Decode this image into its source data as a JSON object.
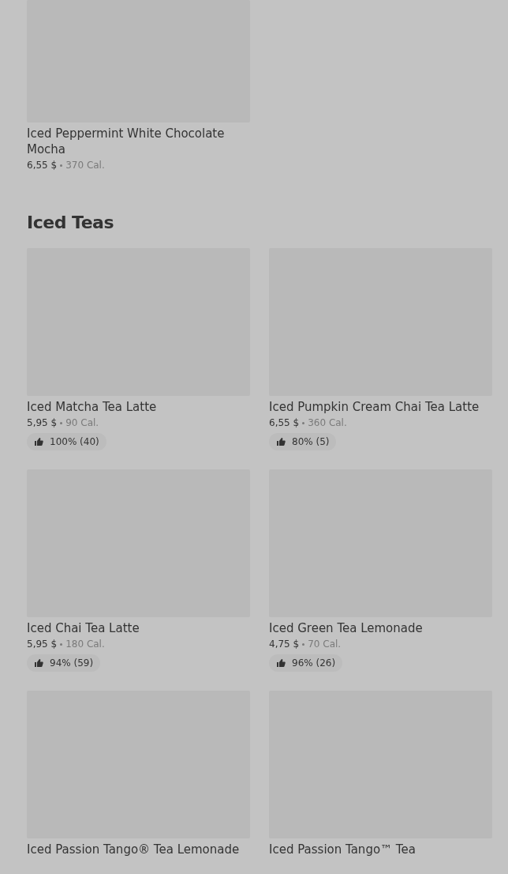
{
  "top_item": {
    "name": "Iced Peppermint White Chocolate Mocha",
    "price": "6,55 $",
    "calories": "370 Cal."
  },
  "section": {
    "title": "Iced Teas",
    "items": [
      {
        "name": "Iced Matcha Tea Latte",
        "price": "5,95 $",
        "calories": "90 Cal.",
        "rating": "100% (40)"
      },
      {
        "name": "Iced Pumpkin Cream Chai Tea Latte",
        "price": "6,55 $",
        "calories": "360 Cal.",
        "rating": "80% (5)"
      },
      {
        "name": "Iced Chai Tea Latte",
        "price": "5,95 $",
        "calories": "180 Cal.",
        "rating": "94% (59)"
      },
      {
        "name": "Iced Green Tea Lemonade",
        "price": "4,75 $",
        "calories": "70 Cal.",
        "rating": "96% (26)"
      },
      {
        "name": "Iced Passion Tango® Tea Lemonade"
      },
      {
        "name": "Iced Passion Tango™ Tea"
      }
    ]
  }
}
